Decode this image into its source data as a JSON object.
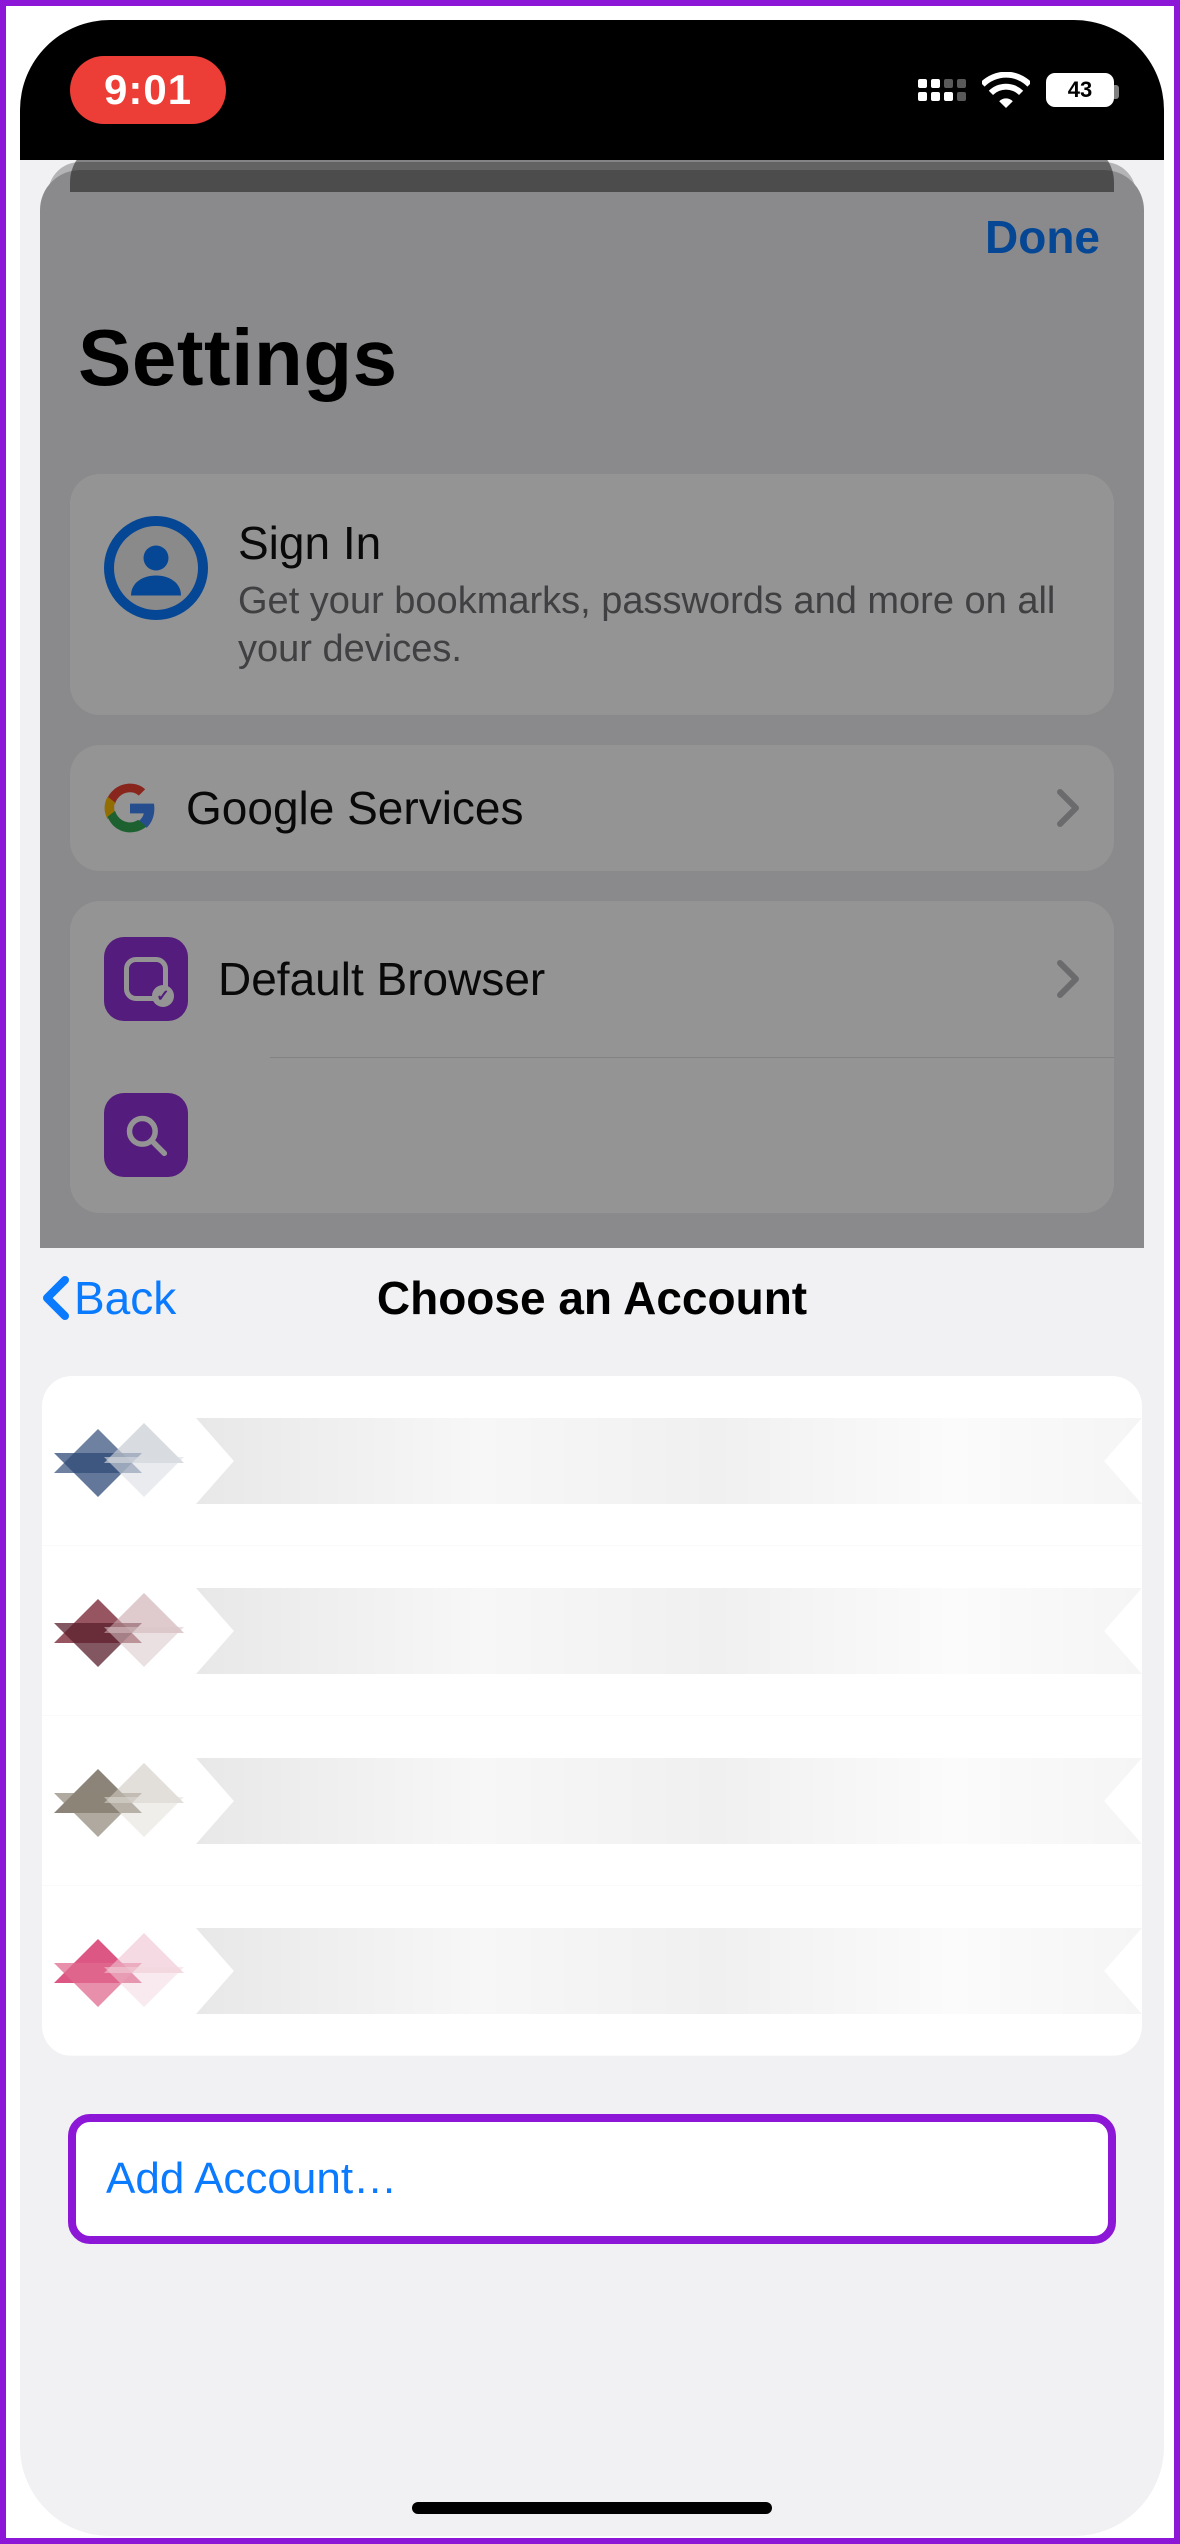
{
  "statusbar": {
    "time": "9:01",
    "battery": "43"
  },
  "settings_sheet": {
    "done": "Done",
    "title": "Settings",
    "signin": {
      "title": "Sign In",
      "subtitle": "Get your bookmarks, passwords and more on all your devices."
    },
    "rows": {
      "google_services": "Google Services",
      "default_browser": "Default Browser"
    }
  },
  "chooser_sheet": {
    "back": "Back",
    "title": "Choose an Account",
    "add_account": "Add Account…"
  }
}
